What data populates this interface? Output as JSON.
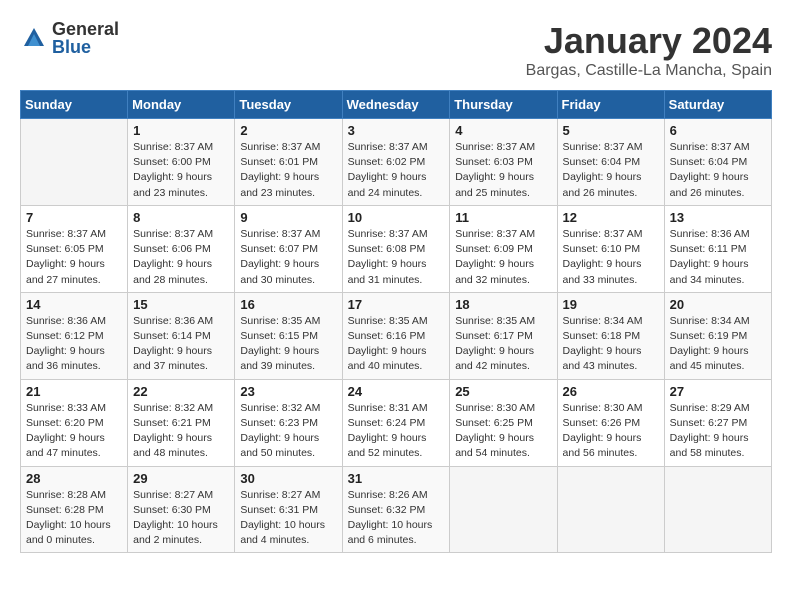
{
  "logo": {
    "general": "General",
    "blue": "Blue"
  },
  "header": {
    "month": "January 2024",
    "location": "Bargas, Castille-La Mancha, Spain"
  },
  "days_of_week": [
    "Sunday",
    "Monday",
    "Tuesday",
    "Wednesday",
    "Thursday",
    "Friday",
    "Saturday"
  ],
  "weeks": [
    [
      {
        "day": "",
        "sunrise": "",
        "sunset": "",
        "daylight": ""
      },
      {
        "day": "1",
        "sunrise": "Sunrise: 8:37 AM",
        "sunset": "Sunset: 6:00 PM",
        "daylight": "Daylight: 9 hours and 23 minutes."
      },
      {
        "day": "2",
        "sunrise": "Sunrise: 8:37 AM",
        "sunset": "Sunset: 6:01 PM",
        "daylight": "Daylight: 9 hours and 23 minutes."
      },
      {
        "day": "3",
        "sunrise": "Sunrise: 8:37 AM",
        "sunset": "Sunset: 6:02 PM",
        "daylight": "Daylight: 9 hours and 24 minutes."
      },
      {
        "day": "4",
        "sunrise": "Sunrise: 8:37 AM",
        "sunset": "Sunset: 6:03 PM",
        "daylight": "Daylight: 9 hours and 25 minutes."
      },
      {
        "day": "5",
        "sunrise": "Sunrise: 8:37 AM",
        "sunset": "Sunset: 6:04 PM",
        "daylight": "Daylight: 9 hours and 26 minutes."
      },
      {
        "day": "6",
        "sunrise": "Sunrise: 8:37 AM",
        "sunset": "Sunset: 6:04 PM",
        "daylight": "Daylight: 9 hours and 26 minutes."
      }
    ],
    [
      {
        "day": "7",
        "sunrise": "Sunrise: 8:37 AM",
        "sunset": "Sunset: 6:05 PM",
        "daylight": "Daylight: 9 hours and 27 minutes."
      },
      {
        "day": "8",
        "sunrise": "Sunrise: 8:37 AM",
        "sunset": "Sunset: 6:06 PM",
        "daylight": "Daylight: 9 hours and 28 minutes."
      },
      {
        "day": "9",
        "sunrise": "Sunrise: 8:37 AM",
        "sunset": "Sunset: 6:07 PM",
        "daylight": "Daylight: 9 hours and 30 minutes."
      },
      {
        "day": "10",
        "sunrise": "Sunrise: 8:37 AM",
        "sunset": "Sunset: 6:08 PM",
        "daylight": "Daylight: 9 hours and 31 minutes."
      },
      {
        "day": "11",
        "sunrise": "Sunrise: 8:37 AM",
        "sunset": "Sunset: 6:09 PM",
        "daylight": "Daylight: 9 hours and 32 minutes."
      },
      {
        "day": "12",
        "sunrise": "Sunrise: 8:37 AM",
        "sunset": "Sunset: 6:10 PM",
        "daylight": "Daylight: 9 hours and 33 minutes."
      },
      {
        "day": "13",
        "sunrise": "Sunrise: 8:36 AM",
        "sunset": "Sunset: 6:11 PM",
        "daylight": "Daylight: 9 hours and 34 minutes."
      }
    ],
    [
      {
        "day": "14",
        "sunrise": "Sunrise: 8:36 AM",
        "sunset": "Sunset: 6:12 PM",
        "daylight": "Daylight: 9 hours and 36 minutes."
      },
      {
        "day": "15",
        "sunrise": "Sunrise: 8:36 AM",
        "sunset": "Sunset: 6:14 PM",
        "daylight": "Daylight: 9 hours and 37 minutes."
      },
      {
        "day": "16",
        "sunrise": "Sunrise: 8:35 AM",
        "sunset": "Sunset: 6:15 PM",
        "daylight": "Daylight: 9 hours and 39 minutes."
      },
      {
        "day": "17",
        "sunrise": "Sunrise: 8:35 AM",
        "sunset": "Sunset: 6:16 PM",
        "daylight": "Daylight: 9 hours and 40 minutes."
      },
      {
        "day": "18",
        "sunrise": "Sunrise: 8:35 AM",
        "sunset": "Sunset: 6:17 PM",
        "daylight": "Daylight: 9 hours and 42 minutes."
      },
      {
        "day": "19",
        "sunrise": "Sunrise: 8:34 AM",
        "sunset": "Sunset: 6:18 PM",
        "daylight": "Daylight: 9 hours and 43 minutes."
      },
      {
        "day": "20",
        "sunrise": "Sunrise: 8:34 AM",
        "sunset": "Sunset: 6:19 PM",
        "daylight": "Daylight: 9 hours and 45 minutes."
      }
    ],
    [
      {
        "day": "21",
        "sunrise": "Sunrise: 8:33 AM",
        "sunset": "Sunset: 6:20 PM",
        "daylight": "Daylight: 9 hours and 47 minutes."
      },
      {
        "day": "22",
        "sunrise": "Sunrise: 8:32 AM",
        "sunset": "Sunset: 6:21 PM",
        "daylight": "Daylight: 9 hours and 48 minutes."
      },
      {
        "day": "23",
        "sunrise": "Sunrise: 8:32 AM",
        "sunset": "Sunset: 6:23 PM",
        "daylight": "Daylight: 9 hours and 50 minutes."
      },
      {
        "day": "24",
        "sunrise": "Sunrise: 8:31 AM",
        "sunset": "Sunset: 6:24 PM",
        "daylight": "Daylight: 9 hours and 52 minutes."
      },
      {
        "day": "25",
        "sunrise": "Sunrise: 8:30 AM",
        "sunset": "Sunset: 6:25 PM",
        "daylight": "Daylight: 9 hours and 54 minutes."
      },
      {
        "day": "26",
        "sunrise": "Sunrise: 8:30 AM",
        "sunset": "Sunset: 6:26 PM",
        "daylight": "Daylight: 9 hours and 56 minutes."
      },
      {
        "day": "27",
        "sunrise": "Sunrise: 8:29 AM",
        "sunset": "Sunset: 6:27 PM",
        "daylight": "Daylight: 9 hours and 58 minutes."
      }
    ],
    [
      {
        "day": "28",
        "sunrise": "Sunrise: 8:28 AM",
        "sunset": "Sunset: 6:28 PM",
        "daylight": "Daylight: 10 hours and 0 minutes."
      },
      {
        "day": "29",
        "sunrise": "Sunrise: 8:27 AM",
        "sunset": "Sunset: 6:30 PM",
        "daylight": "Daylight: 10 hours and 2 minutes."
      },
      {
        "day": "30",
        "sunrise": "Sunrise: 8:27 AM",
        "sunset": "Sunset: 6:31 PM",
        "daylight": "Daylight: 10 hours and 4 minutes."
      },
      {
        "day": "31",
        "sunrise": "Sunrise: 8:26 AM",
        "sunset": "Sunset: 6:32 PM",
        "daylight": "Daylight: 10 hours and 6 minutes."
      },
      {
        "day": "",
        "sunrise": "",
        "sunset": "",
        "daylight": ""
      },
      {
        "day": "",
        "sunrise": "",
        "sunset": "",
        "daylight": ""
      },
      {
        "day": "",
        "sunrise": "",
        "sunset": "",
        "daylight": ""
      }
    ]
  ]
}
